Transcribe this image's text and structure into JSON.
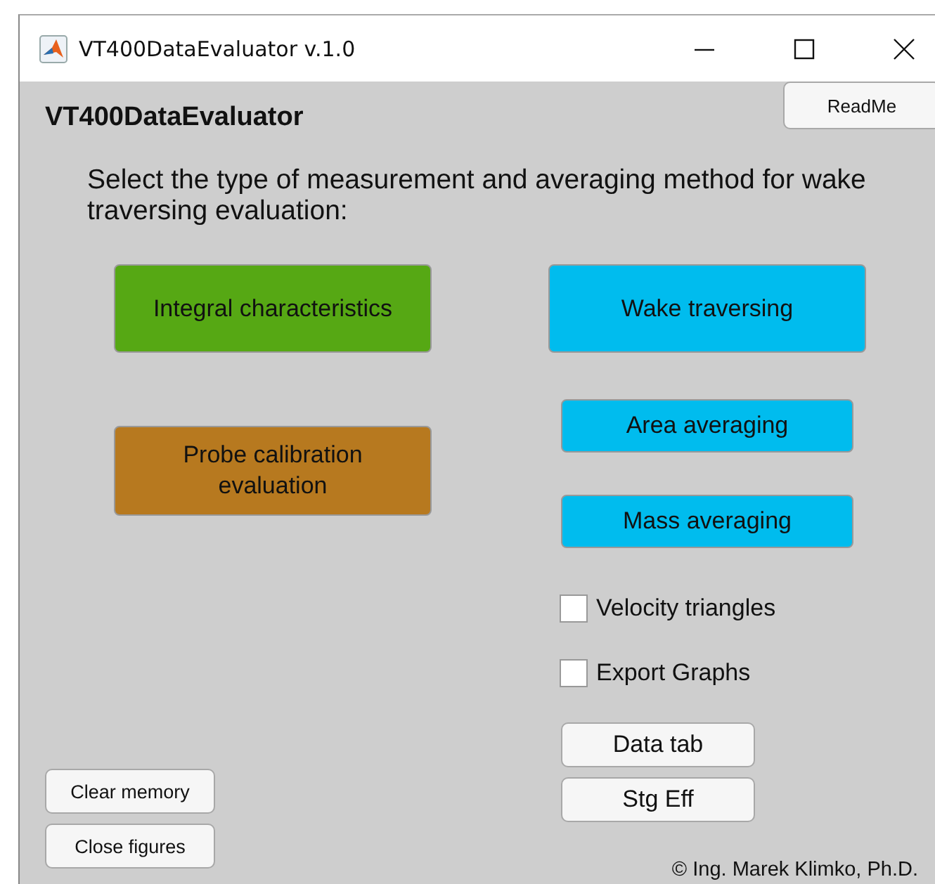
{
  "window": {
    "title": "VT400DataEvaluator v.1.0"
  },
  "app_title": "VT400DataEvaluator",
  "readme_button": "ReadMe",
  "instruction": "Select the type of measurement and averaging method for wake traversing evaluation:",
  "big_buttons": [
    {
      "label": "Integral characteristics",
      "color": "#56a814"
    },
    {
      "label": "Wake traversing",
      "color": "#00bcee"
    },
    {
      "label": "Probe calibration evaluation",
      "color": "#b7791f"
    }
  ],
  "averaging_buttons": [
    {
      "label": "Area averaging",
      "color": "#00bcee"
    },
    {
      "label": "Mass averaging",
      "color": "#00bcee"
    }
  ],
  "checkboxes": [
    {
      "label": "Velocity triangles",
      "checked": false
    },
    {
      "label": "Export Graphs",
      "checked": false
    }
  ],
  "right_buttons": [
    "Data tab",
    "Stg Eff"
  ],
  "left_buttons": [
    "Clear memory",
    "Close figures"
  ],
  "copyright": "© Ing. Marek Klimko, Ph.D."
}
